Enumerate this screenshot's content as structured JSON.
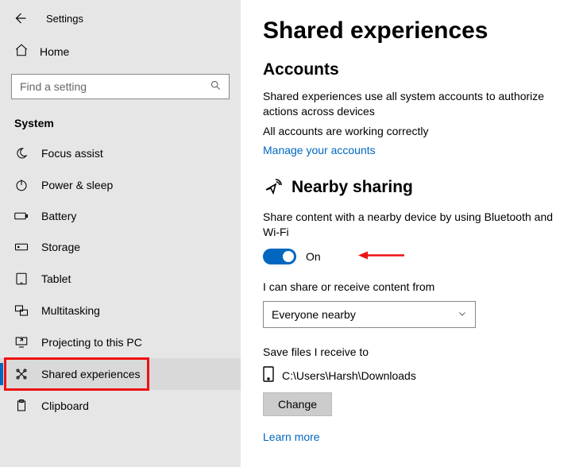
{
  "window": {
    "title": "Settings"
  },
  "sidebar": {
    "home_label": "Home",
    "search_placeholder": "Find a setting",
    "section_label": "System",
    "items": [
      {
        "label": "Focus assist"
      },
      {
        "label": "Power & sleep"
      },
      {
        "label": "Battery"
      },
      {
        "label": "Storage"
      },
      {
        "label": "Tablet"
      },
      {
        "label": "Multitasking"
      },
      {
        "label": "Projecting to this PC"
      },
      {
        "label": "Shared experiences"
      },
      {
        "label": "Clipboard"
      }
    ]
  },
  "page": {
    "title": "Shared experiences",
    "accounts": {
      "heading": "Accounts",
      "desc": "Shared experiences use all system accounts to authorize actions across devices",
      "status": "All accounts are working correctly",
      "manage_link": "Manage your accounts"
    },
    "nearby": {
      "heading": "Nearby sharing",
      "desc": "Share content with a nearby device by using Bluetooth and Wi-Fi",
      "toggle_label": "On",
      "receive_label": "I can share or receive content from",
      "receive_value": "Everyone nearby",
      "save_label": "Save files I receive to",
      "save_path": "C:\\Users\\Harsh\\Downloads",
      "change_btn": "Change",
      "learn_more": "Learn more"
    }
  }
}
